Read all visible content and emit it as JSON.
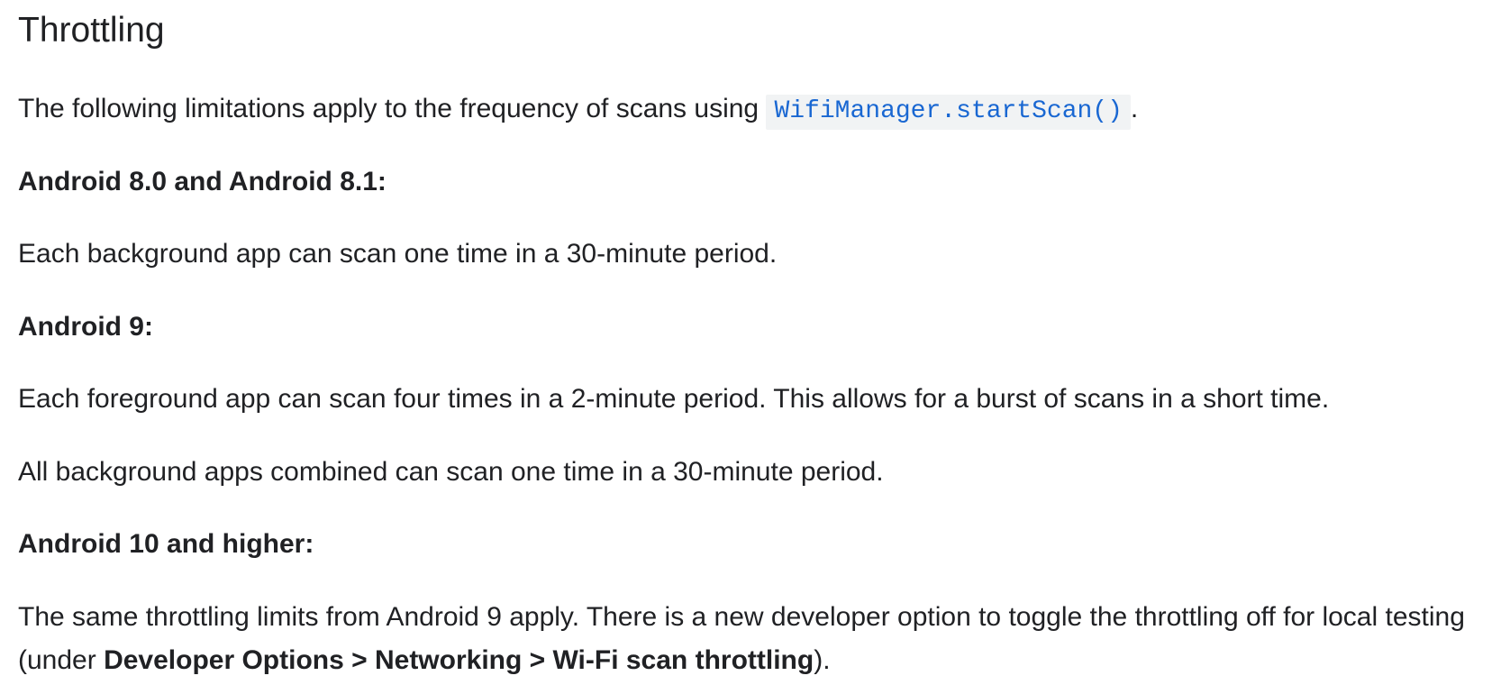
{
  "section": {
    "title": "Throttling"
  },
  "intro": {
    "text_before": "The following limitations apply to the frequency of scans using ",
    "code": "WifiManager.startScan()",
    "text_after": "."
  },
  "android_8": {
    "heading": "Android 8.0 and Android 8.1:",
    "text": "Each background app can scan one time in a 30-minute period."
  },
  "android_9": {
    "heading": "Android 9:",
    "foreground_text": "Each foreground app can scan four times in a 2-minute period. This allows for a burst of scans in a short time.",
    "background_text": "All background apps combined can scan one time in a 30-minute period."
  },
  "android_10": {
    "heading": "Android 10 and higher:",
    "text_before": "The same throttling limits from Android 9 apply. There is a new developer option to toggle the throttling off for local testing (under ",
    "setting_path": "Developer Options > Networking > Wi-Fi scan throttling",
    "text_after": ")."
  },
  "colors": {
    "text": "#202124",
    "code_text": "#1967d2",
    "code_background": "#f1f3f4"
  }
}
